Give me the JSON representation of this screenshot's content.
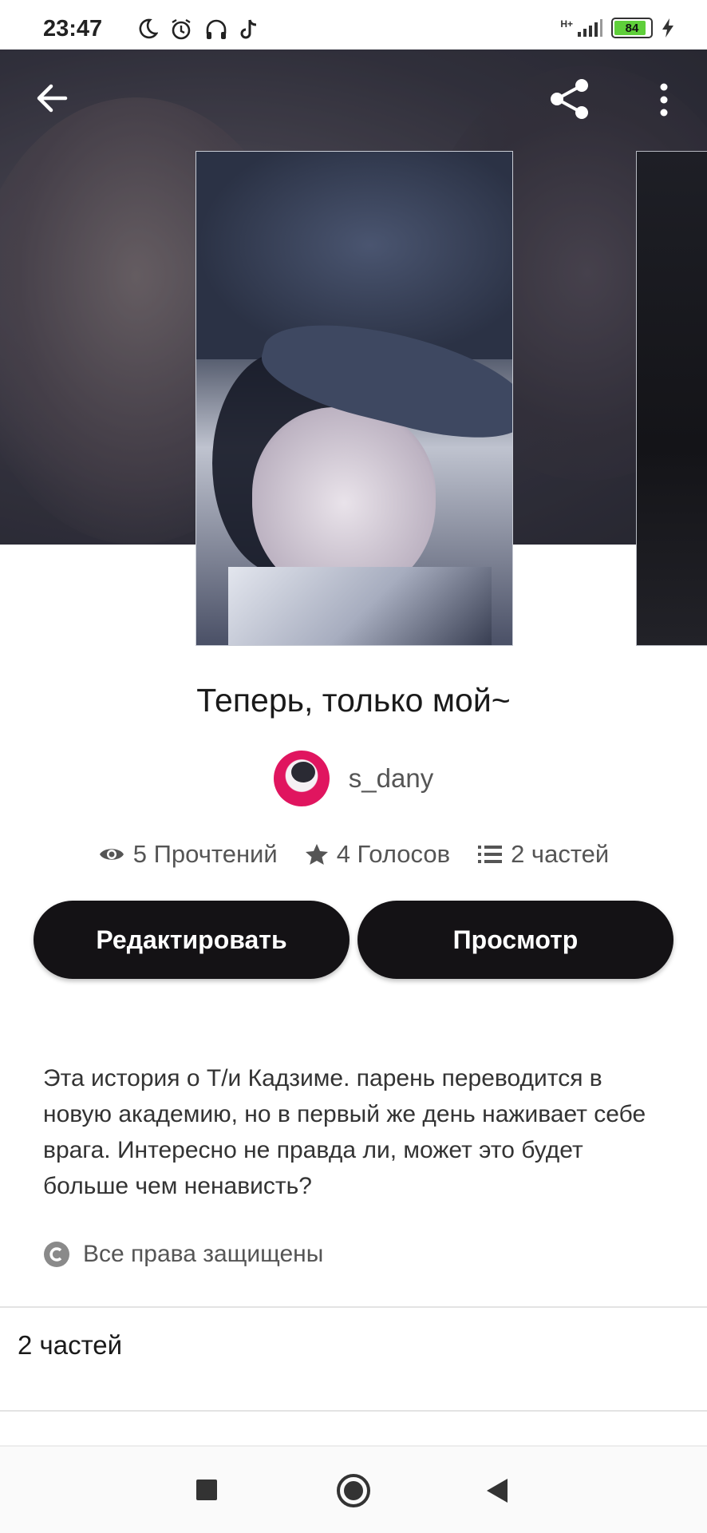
{
  "status_bar": {
    "time": "23:47",
    "left_icons": [
      "moon-icon",
      "alarm-icon",
      "headphones-icon",
      "tiktok-icon"
    ],
    "network_label": "H+",
    "battery_level": "84"
  },
  "topbar": {
    "back_icon": "arrow-left-icon",
    "share_icon": "share-icon",
    "more_icon": "more-vertical-icon"
  },
  "story": {
    "title": "Теперь, только мой~",
    "author": "s_dany",
    "stats": {
      "reads": "5 Прочтений",
      "votes": "4 Голосов",
      "parts": "2 частей"
    },
    "buttons": {
      "edit": "Редактировать",
      "view": "Просмотр"
    },
    "description": "Эта история о Т/и Кадзиме. парень переводится в новую академию, но в первый же день наживает себе врага. Интересно не правда ли, может это будет больше чем ненависть?",
    "rights": "Все права защищены",
    "parts_header": "2 частей"
  },
  "nav": {
    "recent_icon": "square-icon",
    "home_icon": "circle-icon",
    "back_icon": "triangle-back-icon"
  },
  "colors": {
    "button_bg": "#141215",
    "battery_fill": "#5fcf3a"
  }
}
